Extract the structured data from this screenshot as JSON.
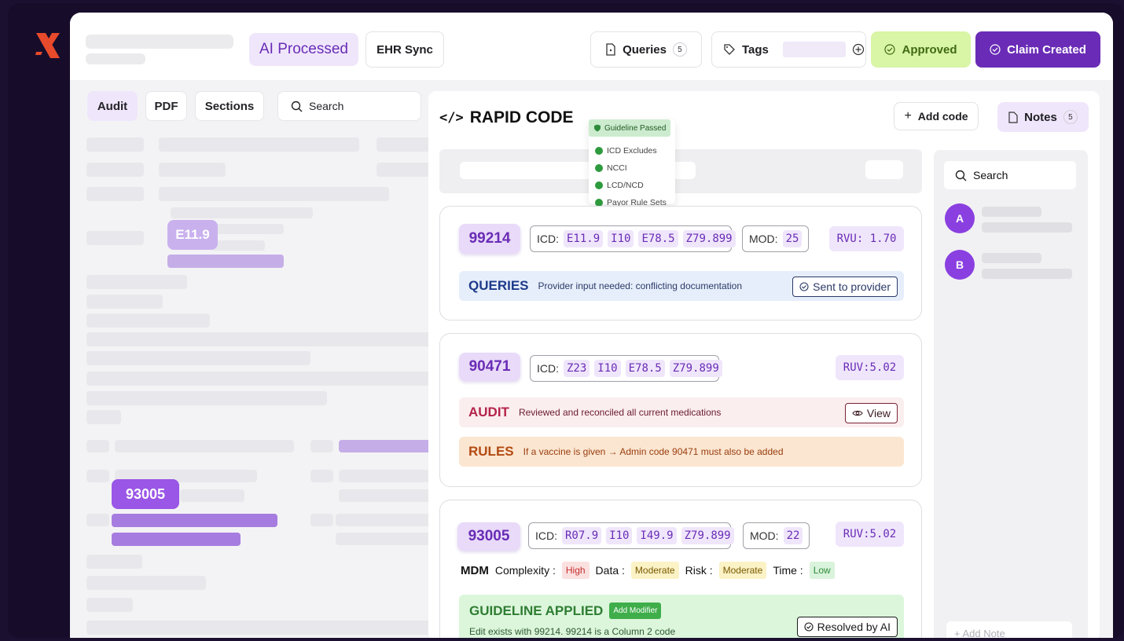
{
  "topbar": {
    "ai_processed": "AI Processed",
    "ehr_sync": "EHR Sync",
    "queries_label": "Queries",
    "queries_count": "5",
    "tags_label": "Tags",
    "approved": "Approved",
    "claim_created": "Claim Created"
  },
  "left_tabs": {
    "audit": "Audit",
    "pdf": "PDF",
    "sections": "Sections",
    "search_placeholder": "Search"
  },
  "doc_highlights": {
    "code1": "E11.9",
    "code2": "93005"
  },
  "rapid": {
    "title": "RAPID CODE",
    "guideline_badge": "Guideline Passed",
    "checks": [
      "ICD Excludes",
      "NCCI",
      "LCD/NCD",
      "Payor Rule Sets"
    ],
    "add_code": "Add code",
    "notes_label": "Notes",
    "notes_count": "5"
  },
  "cards": [
    {
      "cpt": "99214",
      "icd_label": "ICD:",
      "icd": [
        "E11.9",
        "I10",
        "E78.5",
        "Z79.899"
      ],
      "mod_label": "MOD:",
      "mod": "25",
      "rvu": "RVU: 1.70",
      "queries_head": "QUERIES",
      "queries_text": "Provider input needed: conflicting documentation",
      "queries_btn": "Sent to provider"
    },
    {
      "cpt": "90471",
      "icd_label": "ICD:",
      "icd": [
        "Z23",
        "I10",
        "E78.5",
        "Z79.899"
      ],
      "rvu": "RUV:5.02",
      "audit_head": "AUDIT",
      "audit_text": "Reviewed and reconciled all current medications",
      "audit_btn": "View",
      "rules_head": "RULES",
      "rules_text": "If a vaccine is given → Admin code 90471 must also be added"
    },
    {
      "cpt": "93005",
      "icd_label": "ICD:",
      "icd": [
        "R07.9",
        "I10",
        "I49.9",
        "Z79.899"
      ],
      "mod_label": "MOD:",
      "mod": "22",
      "rvu": "RUV:5.02",
      "mdm_label": "MDM",
      "complexity_label": "Complexity :",
      "complexity": "High",
      "data_label": "Data :",
      "data": "Moderate",
      "risk_label": "Risk :",
      "risk": "Moderate",
      "time_label": "Time :",
      "time": "Low",
      "guideline_head": "GUIDELINE APPLIED",
      "add_modifier": "Add Modifier",
      "guideline_text": "Edit exists with 99214. 99214 is a Column 2 code",
      "resolved_btn": "Resolved by AI"
    }
  ],
  "notes_panel": {
    "search_placeholder": "Search",
    "avatars": [
      "A",
      "B"
    ],
    "add_note": "+ Add Note"
  },
  "colors": {
    "brand_purple": "#6a2cb6",
    "approved_bg": "#d9f5a6",
    "logo_red": "#e84a2c"
  }
}
